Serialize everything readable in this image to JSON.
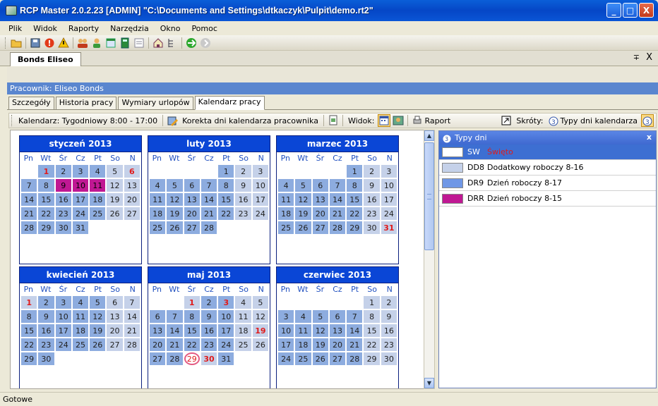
{
  "window": {
    "title": "RCP Master 2.0.2.23  [ADMIN] \"C:\\Documents and Settings\\dtkaczyk\\Pulpit\\demo.rt2\"",
    "buttons": {
      "minimize": "_",
      "maximize": "□",
      "close": "X"
    }
  },
  "menu": [
    "Plik",
    "Widok",
    "Raporty",
    "Narzędzia",
    "Okno",
    "Pomoc"
  ],
  "toolbar_icons": [
    "folder-open-icon",
    "save-icon",
    "stop-icon",
    "warning-icon",
    "users-icon",
    "user-icon",
    "calendar-icon",
    "calculator-icon",
    "list-icon",
    "home-icon",
    "tree-icon",
    "forward-icon",
    "back-icon"
  ],
  "doc_tab": {
    "label": "Bonds Eliseo",
    "pin": "∓",
    "close": "X"
  },
  "employee_bar": "Pracownik: Eliseo Bonds",
  "subtabs": [
    "Szczegóły",
    "Historia pracy",
    "Wymiary urlopów",
    "Kalendarz pracy"
  ],
  "active_subtab": 3,
  "cal_toolbar": {
    "calendar_label": "Kalendarz:",
    "calendar_value": "Tygodniowy 8:00 - 17:00",
    "correction": "Korekta dni kalendarza pracownika",
    "view_label": "Widok:",
    "report": "Raport",
    "shortcuts": "Skróty:",
    "day_types": "Typy dni kalendarza"
  },
  "dow": [
    "Pn",
    "Wt",
    "Śr",
    "Cz",
    "Pt",
    "So",
    "N"
  ],
  "months": [
    {
      "name": "styczeń 2013",
      "offset": 1,
      "days": 31,
      "red": [
        1,
        6
      ],
      "magenta": [
        9,
        10,
        11
      ],
      "white": [
        5,
        6,
        12,
        13,
        19,
        20,
        26,
        27
      ],
      "circ": []
    },
    {
      "name": "luty 2013",
      "offset": 4,
      "days": 28,
      "red": [],
      "magenta": [],
      "white": [
        2,
        3,
        9,
        10,
        16,
        17,
        23,
        24
      ],
      "circ": []
    },
    {
      "name": "marzec 2013",
      "offset": 4,
      "days": 31,
      "red": [
        31
      ],
      "magenta": [],
      "white": [
        2,
        3,
        9,
        10,
        16,
        17,
        23,
        24,
        30,
        31
      ],
      "circ": []
    },
    {
      "name": "kwiecień 2013",
      "offset": 0,
      "days": 30,
      "red": [
        1
      ],
      "magenta": [],
      "white": [
        1,
        6,
        7,
        13,
        14,
        20,
        21,
        27,
        28
      ],
      "circ": []
    },
    {
      "name": "maj 2013",
      "offset": 2,
      "days": 31,
      "red": [
        1,
        3,
        19,
        30
      ],
      "magenta": [],
      "white": [
        1,
        4,
        5,
        11,
        12,
        18,
        19,
        25,
        26,
        29,
        30
      ],
      "circ": [
        29
      ]
    },
    {
      "name": "czerwiec 2013",
      "offset": 5,
      "days": 30,
      "red": [],
      "magenta": [],
      "white": [
        1,
        2,
        8,
        9,
        15,
        16,
        22,
        23,
        29,
        30
      ],
      "circ": []
    }
  ],
  "day_types_panel": {
    "title": "Typy dni",
    "close": "x",
    "rows": [
      {
        "code": "SW",
        "name": "Święto",
        "color": "#ffffff",
        "selected": true
      },
      {
        "code": "DD8",
        "name": "Dodatkowy roboczy 8-16",
        "color": "#c5d1e9",
        "selected": false
      },
      {
        "code": "DR9",
        "name": "Dzień roboczy 8-17",
        "color": "#6f97e6",
        "selected": false
      },
      {
        "code": "DRR",
        "name": "Dzień roboczy 8-15",
        "color": "#c01893",
        "selected": false
      }
    ]
  },
  "status": "Gotowe"
}
